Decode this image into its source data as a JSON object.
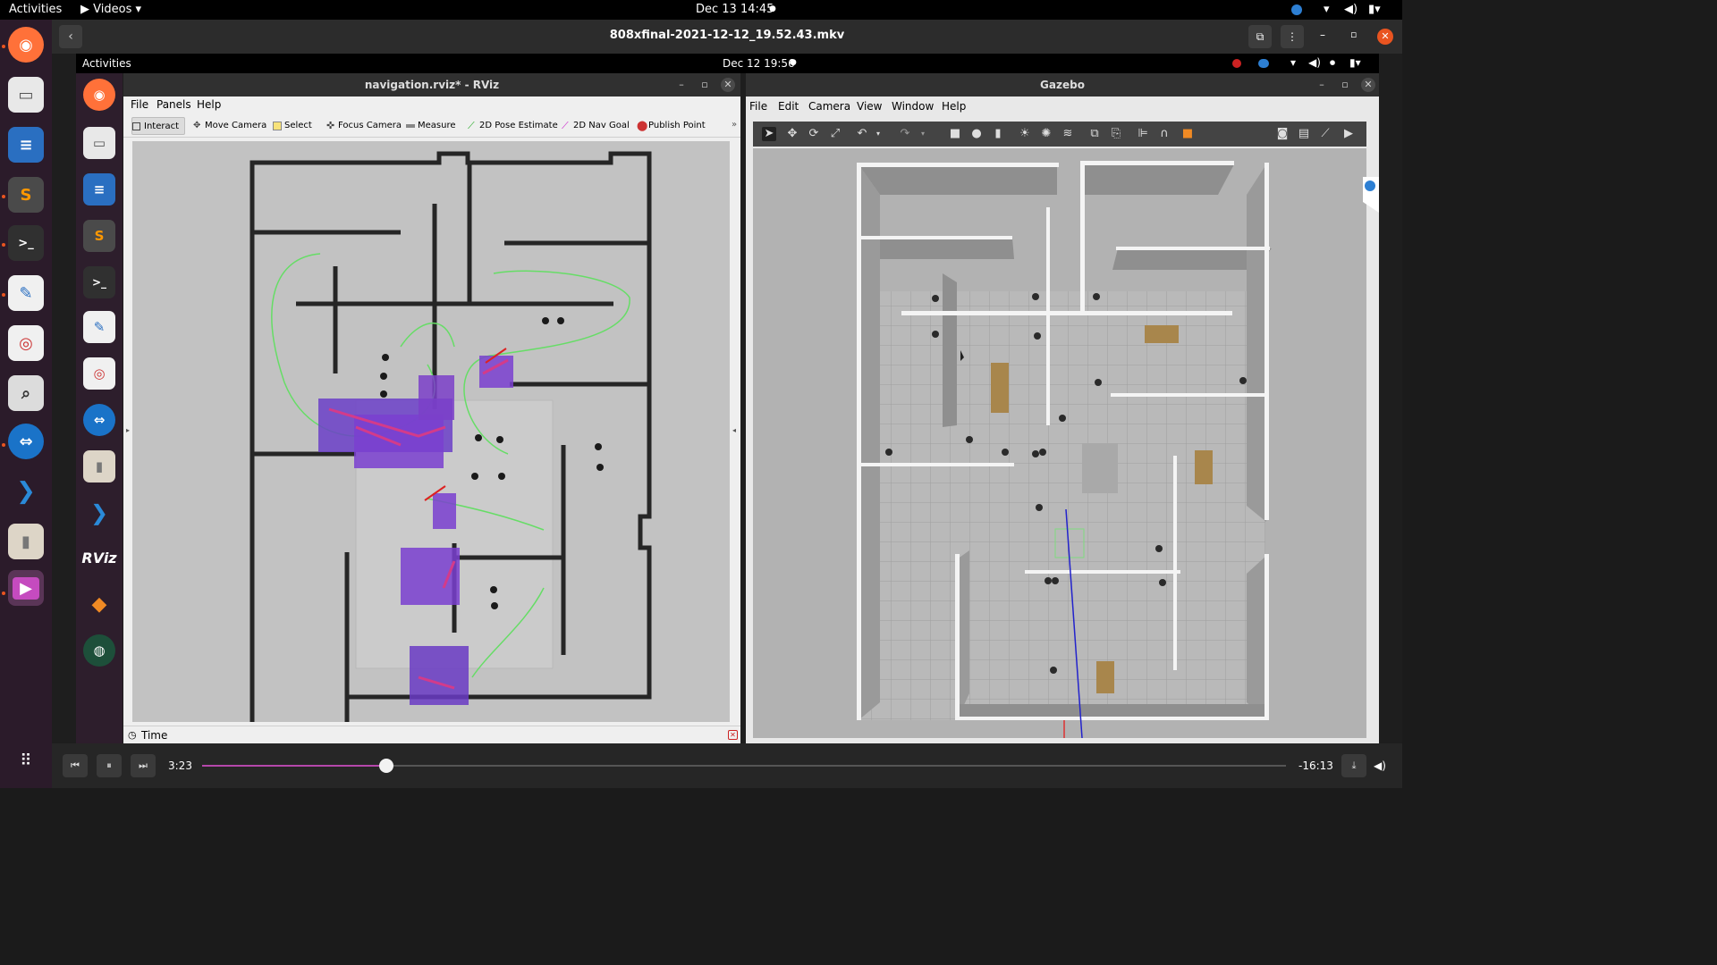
{
  "host": {
    "activities": "Activities",
    "app_menu": "Videos",
    "clock": "Dec 13  14:45",
    "dock": [
      "firefox-icon",
      "files-icon",
      "writer-icon",
      "sublime-icon",
      "terminal-icon",
      "text-editor-icon",
      "document-viewer-icon",
      "search-icon",
      "teamviewer-icon",
      "vscode-icon",
      "archive-icon",
      "videos-icon"
    ]
  },
  "player": {
    "title": "808xfinal-2021-12-12_19.52.43.mkv",
    "elapsed": "3:23",
    "remaining": "-16:13",
    "progress": 0.17
  },
  "inner": {
    "activities": "Activities",
    "clock": "Dec 12  19:56",
    "dock": [
      "firefox-icon",
      "files-icon",
      "writer-icon",
      "sublime-icon",
      "terminal-icon",
      "text-editor-icon",
      "document-viewer-icon",
      "teamviewer-icon",
      "archive-icon",
      "vscode-icon",
      "rviz-icon",
      "stack-icon",
      "camera-icon"
    ]
  },
  "rviz": {
    "title": "navigation.rviz* - RViz",
    "menu": [
      "File",
      "Panels",
      "Help"
    ],
    "tools": [
      "Interact",
      "Move Camera",
      "Select",
      "Focus Camera",
      "Measure",
      "2D Pose Estimate",
      "2D Nav Goal",
      "Publish Point"
    ],
    "time_panel": "Time"
  },
  "gazebo": {
    "title": "Gazebo",
    "menu": [
      "File",
      "Edit",
      "Camera",
      "View",
      "Window",
      "Help"
    ]
  },
  "colors": {
    "accent": "#e95420",
    "path_green": "#66dd66",
    "costmap": "#7a3fd0"
  }
}
